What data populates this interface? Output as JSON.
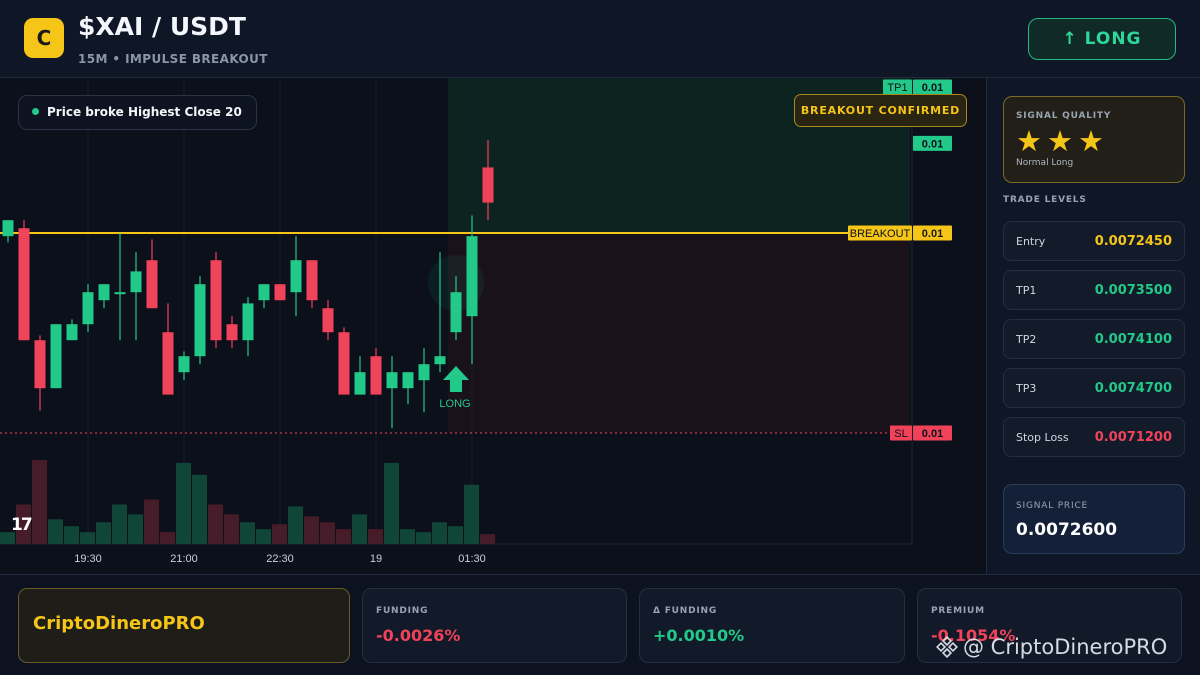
{
  "header": {
    "logo_letter": "C",
    "pair": "$XAI / USDT",
    "subtitle": "15M • IMPULSE BREAKOUT",
    "direction_button": "↑ LONG"
  },
  "chart": {
    "info_badge": "Price broke Highest Close 20",
    "confirm_badge": "BREAKOUT CONFIRMED",
    "tv_logo": "17",
    "signal_arrow_label": "LONG",
    "price_tags": [
      {
        "label": "TP1",
        "value": "0.01",
        "color": "#22c988",
        "price": 0.00735
      },
      {
        "label": "",
        "value": "0.01",
        "color": "#22c988",
        "price": 0.007301
      },
      {
        "label": "BREAKOUT",
        "value": "0.01",
        "color": "#f5c518",
        "price": 0.007245
      },
      {
        "label": "SL",
        "value": "0.01",
        "color": "#f0435a",
        "price": 0.00712
      }
    ],
    "time_labels": [
      "19:30",
      "21:00",
      "22:30",
      "19",
      "01:30"
    ],
    "candles": [
      {
        "o": 0.007243,
        "h": 0.007253,
        "l": 0.007239,
        "c": 0.007253
      },
      {
        "o": 0.007248,
        "h": 0.007253,
        "l": 0.007178,
        "c": 0.007178
      },
      {
        "o": 0.007178,
        "h": 0.007181,
        "l": 0.007134,
        "c": 0.007148
      },
      {
        "o": 0.007148,
        "h": 0.007188,
        "l": 0.007148,
        "c": 0.007188
      },
      {
        "o": 0.007178,
        "h": 0.007191,
        "l": 0.007178,
        "c": 0.007188
      },
      {
        "o": 0.007188,
        "h": 0.007213,
        "l": 0.007183,
        "c": 0.007208
      },
      {
        "o": 0.007203,
        "h": 0.007213,
        "l": 0.007198,
        "c": 0.007213
      },
      {
        "o": 0.007208,
        "h": 0.007245,
        "l": 0.007178,
        "c": 0.007208
      },
      {
        "o": 0.007208,
        "h": 0.007233,
        "l": 0.007178,
        "c": 0.007221
      },
      {
        "o": 0.007228,
        "h": 0.007241,
        "l": 0.007198,
        "c": 0.007198
      },
      {
        "o": 0.007183,
        "h": 0.007201,
        "l": 0.007144,
        "c": 0.007144
      },
      {
        "o": 0.007158,
        "h": 0.007171,
        "l": 0.007153,
        "c": 0.007168
      },
      {
        "o": 0.007168,
        "h": 0.007218,
        "l": 0.007163,
        "c": 0.007213
      },
      {
        "o": 0.007228,
        "h": 0.007233,
        "l": 0.007173,
        "c": 0.007178
      },
      {
        "o": 0.007188,
        "h": 0.007193,
        "l": 0.007173,
        "c": 0.007178
      },
      {
        "o": 0.007178,
        "h": 0.007205,
        "l": 0.007168,
        "c": 0.007201
      },
      {
        "o": 0.007203,
        "h": 0.007213,
        "l": 0.007198,
        "c": 0.007213
      },
      {
        "o": 0.007213,
        "h": 0.007213,
        "l": 0.007203,
        "c": 0.007203
      },
      {
        "o": 0.007208,
        "h": 0.007243,
        "l": 0.007193,
        "c": 0.007228
      },
      {
        "o": 0.007228,
        "h": 0.007228,
        "l": 0.007198,
        "c": 0.007203
      },
      {
        "o": 0.007198,
        "h": 0.007203,
        "l": 0.007178,
        "c": 0.007183
      },
      {
        "o": 0.007183,
        "h": 0.007186,
        "l": 0.007144,
        "c": 0.007144
      },
      {
        "o": 0.007144,
        "h": 0.007168,
        "l": 0.007144,
        "c": 0.007158
      },
      {
        "o": 0.007168,
        "h": 0.007173,
        "l": 0.007144,
        "c": 0.007144
      },
      {
        "o": 0.007148,
        "h": 0.007168,
        "l": 0.007123,
        "c": 0.007158
      },
      {
        "o": 0.007148,
        "h": 0.007158,
        "l": 0.007138,
        "c": 0.007158
      },
      {
        "o": 0.007153,
        "h": 0.007173,
        "l": 0.007133,
        "c": 0.007163
      },
      {
        "o": 0.007163,
        "h": 0.007233,
        "l": 0.007158,
        "c": 0.007168
      },
      {
        "o": 0.007183,
        "h": 0.007218,
        "l": 0.007178,
        "c": 0.007208
      },
      {
        "o": 0.007193,
        "h": 0.007256,
        "l": 0.007163,
        "c": 0.007243
      },
      {
        "o": 0.007286,
        "h": 0.007303,
        "l": 0.007253,
        "c": 0.007264
      }
    ],
    "volumes": [
      12,
      40,
      85,
      25,
      18,
      12,
      22,
      40,
      30,
      45,
      12,
      82,
      70,
      40,
      30,
      22,
      15,
      20,
      38,
      28,
      22,
      15,
      30,
      15,
      82,
      15,
      12,
      22,
      18,
      60,
      10
    ],
    "colors": {
      "up": "#22c988",
      "down": "#f0435a",
      "level": "#f5c518",
      "sl": "#f0435a"
    }
  },
  "sidebar": {
    "quality_label": "SIGNAL QUALITY",
    "stars": "★★★",
    "quality_sub": "Normal Long",
    "levels_title": "TRADE LEVELS",
    "levels": [
      {
        "name": "Entry",
        "value": "0.0072450",
        "color": "#f5c518"
      },
      {
        "name": "TP1",
        "value": "0.0073500",
        "color": "#22c988"
      },
      {
        "name": "TP2",
        "value": "0.0074100",
        "color": "#22c988"
      },
      {
        "name": "TP3",
        "value": "0.0074700",
        "color": "#22c988"
      },
      {
        "name": "Stop Loss",
        "value": "0.0071200",
        "color": "#f0435a"
      }
    ],
    "signal_price_label": "SIGNAL PRICE",
    "signal_price": "0.0072600"
  },
  "footer": {
    "brand": "CriptoDineroPRO",
    "funding_label": "FUNDING",
    "funding_value": "-0.0026%",
    "dfunding_label": "Δ FUNDING",
    "dfunding_value": "+0.0010%",
    "premium_label": "PREMIUM",
    "premium_value": "-0.1054%"
  },
  "watermark": "@ CriptoDineroPRO"
}
